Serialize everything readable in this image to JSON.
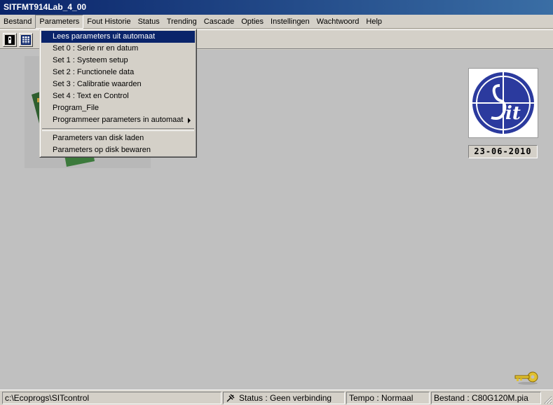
{
  "window": {
    "title": "SITFMT914Lab_4_00"
  },
  "menubar": {
    "items": [
      "Bestand",
      "Parameters",
      "Fout Historie",
      "Status",
      "Trending",
      "Cascade",
      "Opties",
      "Instellingen",
      "Wachtwoord",
      "Help"
    ],
    "open_item": "Parameters"
  },
  "parameters_menu": {
    "items": [
      "Lees parameters uit automaat",
      "Set 0 : Serie nr en datum",
      "Set 1 : Systeem setup",
      "Set 2 : Functionele data",
      "Set 3 : Calibratie waarden",
      "Set 4 : Text en Control",
      "Program_File",
      "Programmeer parameters in automaat",
      "Parameters van disk laden",
      "Parameters op disk bewaren"
    ],
    "highlighted_index": 0,
    "submenu_index": 7
  },
  "toolbar": {
    "icons": [
      "phone-icon",
      "grid-icon"
    ]
  },
  "logo": {
    "text": "Sit",
    "color": "#2b3a9e"
  },
  "date_display": {
    "value": "23-06-2010"
  },
  "statusbar": {
    "path": "c:\\Ecoprogs\\SITcontrol",
    "status": "Status : Geen verbinding",
    "tempo": "Tempo : Normaal",
    "bestand": "Bestand : C80G120M.pia"
  },
  "colors": {
    "title_bar": "#0a246a",
    "menu_highlight": "#0a246a",
    "client_bg": "#c0c0c0",
    "chrome": "#d4d0c8"
  }
}
